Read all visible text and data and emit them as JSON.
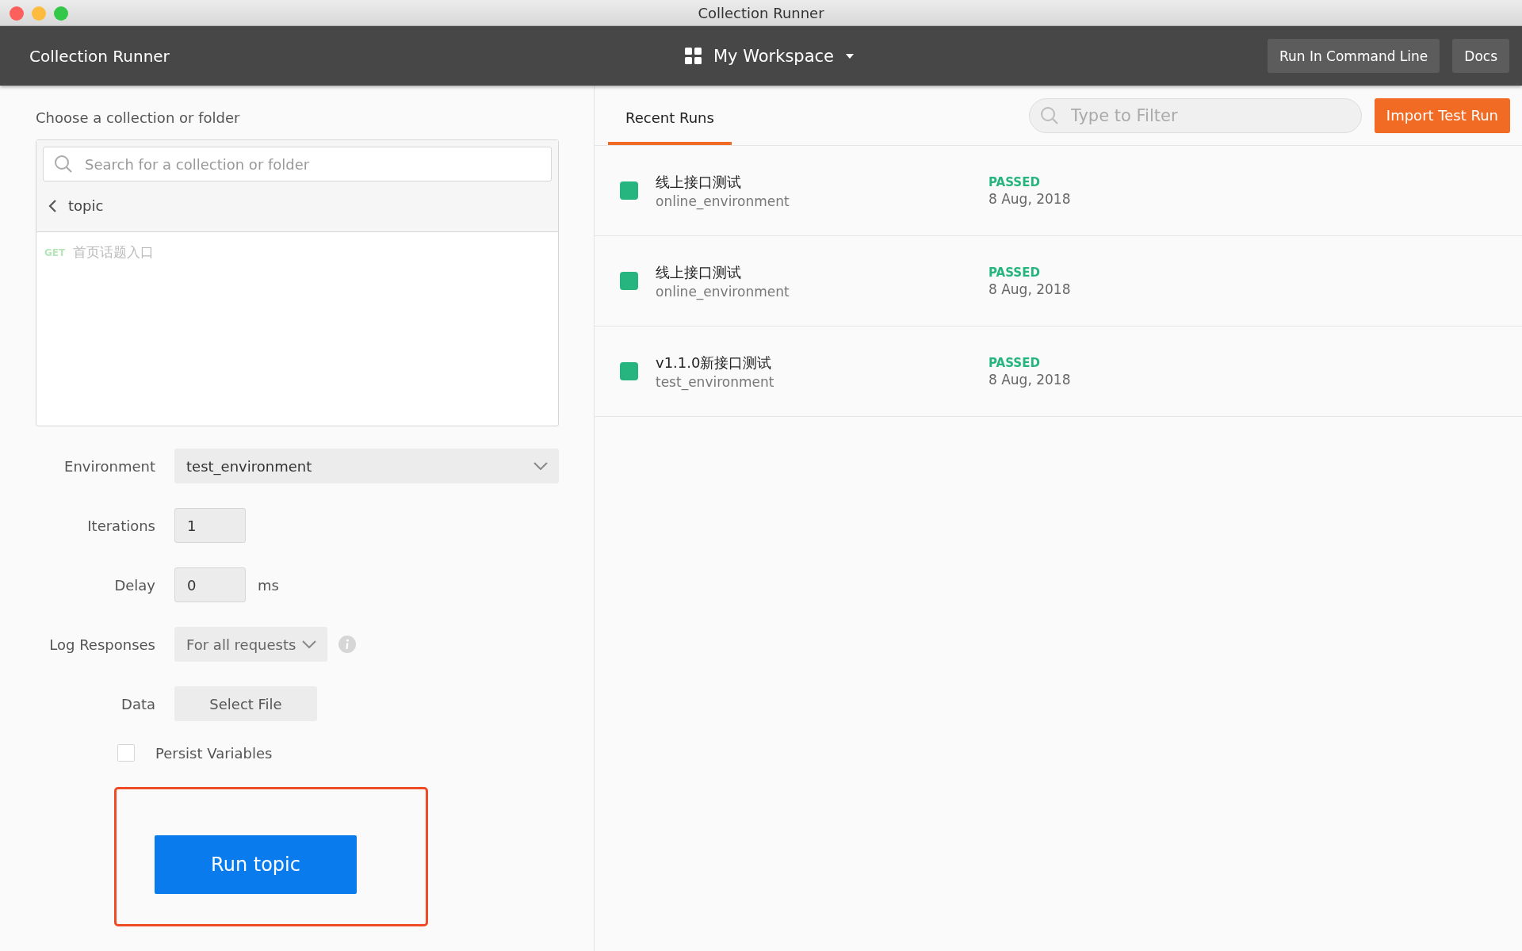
{
  "window": {
    "title": "Collection Runner"
  },
  "header": {
    "title": "Collection Runner",
    "workspace": "My Workspace",
    "buttons": [
      "Run In Command Line",
      "Docs"
    ]
  },
  "collection_picker": {
    "label": "Choose a collection or folder",
    "search": {
      "placeholder": "Search for a collection or folder"
    },
    "folder": "topic",
    "requests": [
      {
        "method": "GET",
        "name": "首页话题入口",
        "disabled": true
      }
    ]
  },
  "settings": {
    "environment": {
      "label": "Environment",
      "value": "test_environment"
    },
    "iterations": {
      "label": "Iterations",
      "value": "1"
    },
    "delay": {
      "label": "Delay",
      "value": "0",
      "unit": "ms"
    },
    "log_responses": {
      "label": "Log Responses",
      "value": "For all requests"
    },
    "data": {
      "label": "Data",
      "button": "Select File"
    },
    "persist_variables": {
      "label": "Persist Variables",
      "checked": false
    },
    "run_button": "Run topic"
  },
  "recent_runs": {
    "tabs": [
      {
        "label": "Recent Runs",
        "selected": true
      }
    ],
    "filter": {
      "placeholder": "Type to Filter"
    },
    "import_button": "Import Test Run",
    "runs": [
      {
        "name": "线上接口测试",
        "environment": "online_environment",
        "status": "PASSED",
        "kind": "passed",
        "date": "8 Aug, 2018"
      },
      {
        "name": "线上接口测试",
        "environment": "online_environment",
        "status": "PASSED",
        "kind": "passed",
        "date": "8 Aug, 2018"
      },
      {
        "name": "v1.1.0新接口测试",
        "environment": "test_environment",
        "status": "PASSED",
        "kind": "passed",
        "date": "8 Aug, 2018"
      }
    ]
  }
}
